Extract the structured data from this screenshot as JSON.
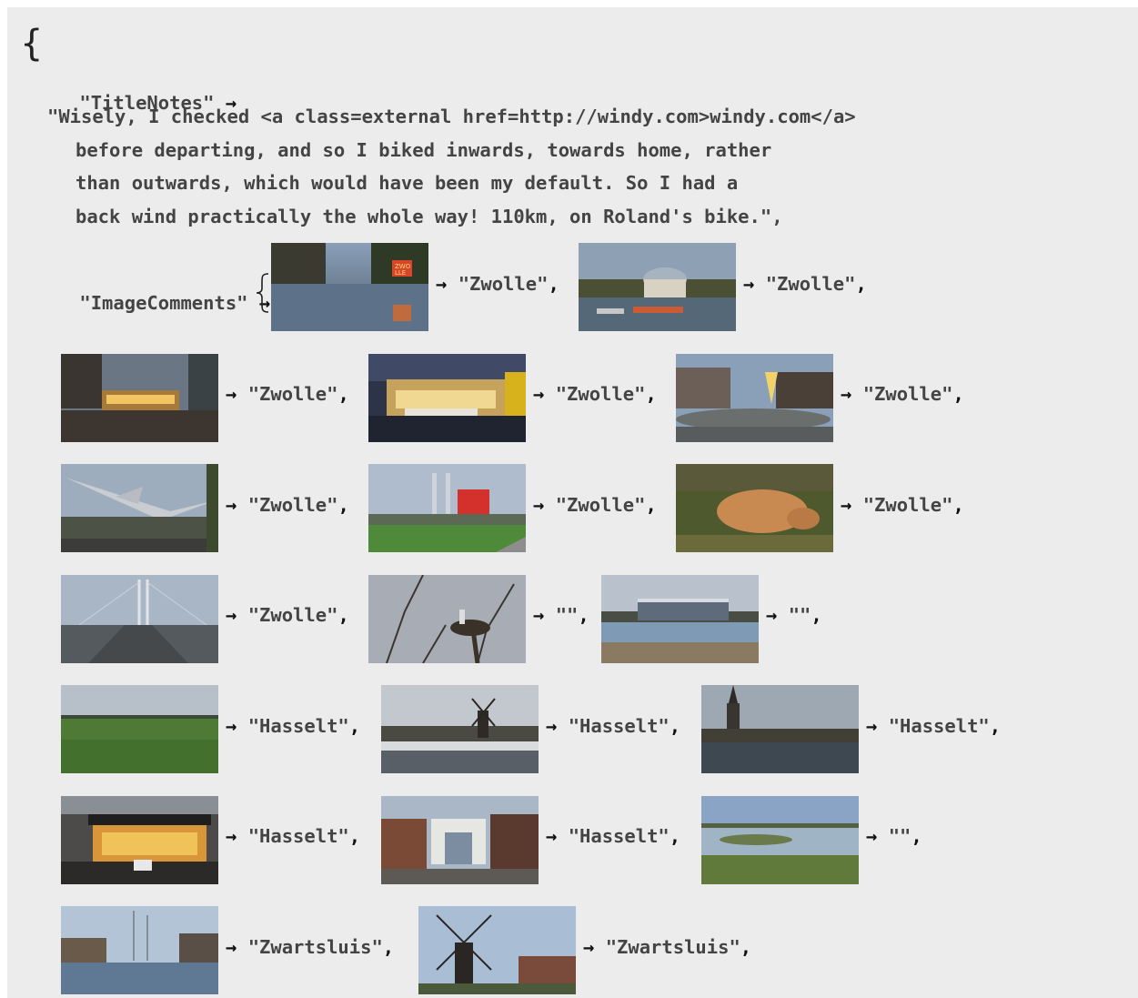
{
  "opening_brace": "{",
  "title_key": "\"TitleNotes\"",
  "arrow": "→",
  "title_lines": [
    "\"Wisely, I checked <a class=external href=http://windy.com>windy.com</a>",
    "before departing, and so I biked inwards, towards home, rather",
    "than outwards, which would have been my default. So I had a",
    "back wind practically the whole way! 110km, on Roland's bike.\","
  ],
  "image_key": "\"ImageComments\"",
  "image_comments": [
    {
      "label": "\"Zwolle\"",
      "icon": "canal-neon-sign-photo"
    },
    {
      "label": "\"Zwolle\"",
      "icon": "museum-dome-photo"
    },
    {
      "label": "\"Zwolle\"",
      "icon": "street-market-night-photo"
    },
    {
      "label": "\"Zwolle\"",
      "icon": "market-stall-photo"
    },
    {
      "label": "\"Zwolle\"",
      "icon": "square-christmas-tree-photo"
    },
    {
      "label": "\"Zwolle\"",
      "icon": "jet-monument-photo"
    },
    {
      "label": "\"Zwolle\"",
      "icon": "red-building-bridge-photo"
    },
    {
      "label": "\"Zwolle\"",
      "icon": "pig-photo"
    },
    {
      "label": "\"Zwolle\"",
      "icon": "cable-bridge-road-photo"
    },
    {
      "label": "\"\"",
      "icon": "stork-nest-photo"
    },
    {
      "label": "\"\"",
      "icon": "riverside-building-photo"
    },
    {
      "label": "\"Hasselt\"",
      "icon": "green-meadow-photo"
    },
    {
      "label": "\"Hasselt\"",
      "icon": "windmill-harbor-photo"
    },
    {
      "label": "\"Hasselt\"",
      "icon": "church-tower-canal-photo"
    },
    {
      "label": "\"Hasselt\"",
      "icon": "cheese-stall-photo"
    },
    {
      "label": "\"Hasselt\"",
      "icon": "town-gate-street-photo"
    },
    {
      "label": "\"\"",
      "icon": "flooded-field-photo"
    },
    {
      "label": "\"Zwartsluis\"",
      "icon": "harbor-boats-photo"
    },
    {
      "label": "\"Zwartsluis\"",
      "icon": "windmill-village-photo"
    }
  ]
}
